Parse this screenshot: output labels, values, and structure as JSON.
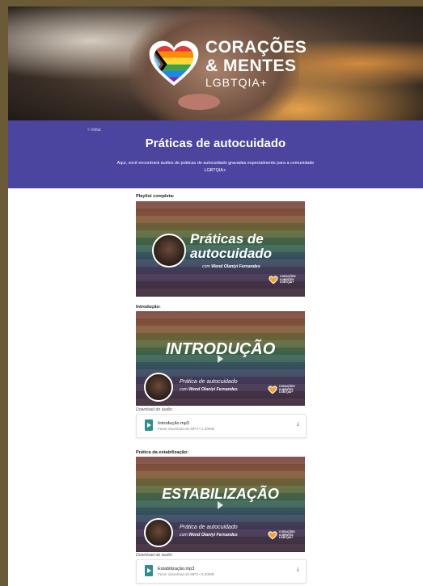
{
  "hero": {
    "logo_line1": "CORAÇÕES",
    "logo_line2": "& MENTES",
    "logo_line3": "LGBTQIA+"
  },
  "header": {
    "back_label": "< Voltar",
    "title": "Práticas de autocuidado",
    "description": "Aqui, você encontrará áudios de práticas de autocuidado gravadas especialmente para a comunidade LGBTQIA+."
  },
  "sections": [
    {
      "label": "Playlist completa:",
      "video_title_line1": "Práticas de",
      "video_title_line2": "autocuidado",
      "video_sub_prefix": "com",
      "video_sub_name": "Wend Olaniyi Fernandes"
    },
    {
      "label": "Introdução:",
      "video_title": "INTRODUÇÃO",
      "video_sub_line1": "Prática de autocuidado",
      "video_sub_prefix": "com",
      "video_sub_name": "Wend Olaniyi Fernandes",
      "download_caption": "Download do áudio:",
      "file_name": "Introdução.mp3",
      "file_meta": "Fazer download do MP3 • 1.30MB"
    },
    {
      "label": "Prática da estabilização:",
      "video_title": "ESTABILIZAÇÃO",
      "video_sub_line1": "Prática de autocuidado",
      "video_sub_prefix": "com",
      "video_sub_name": "Wend Olaniyi Fernandes",
      "download_caption": "Download do áudio:",
      "file_name": "Estabilização.mp3",
      "file_meta": "Fazer download do MP3 • 5.30MB"
    }
  ],
  "mini_logo": {
    "line1": "CORAÇÕES",
    "line2": "& MENTES",
    "line3": "LGBTQIA+"
  },
  "colors": {
    "band": "#4b45a0",
    "file_icon": "#2f8f8a",
    "outer_background": "#6b5a36"
  },
  "icons": [
    "heart-logo-icon",
    "play-icon",
    "audio-file-icon",
    "download-icon"
  ]
}
